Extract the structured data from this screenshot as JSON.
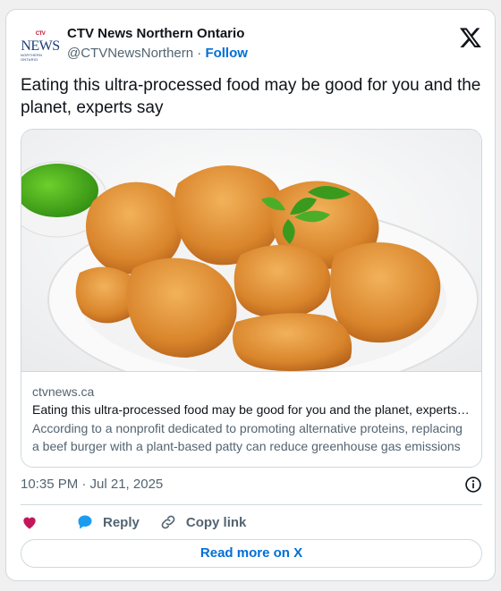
{
  "account": {
    "display_name": "CTV News Northern Ontario",
    "handle": "@CTVNewsNorthern",
    "separator": "·",
    "follow_label": "Follow",
    "logo": {
      "top": "CTV",
      "main": "NEWS",
      "sub": "NORTHERN ONTARIO"
    }
  },
  "tweet": {
    "text": "Eating this ultra-processed food may be good for you and the planet, experts say"
  },
  "link_card": {
    "image_icon": "chicken-nuggets-photo",
    "domain": "ctvnews.ca",
    "title": "Eating this ultra-processed food may be good for you and the planet, experts say",
    "description": "According to a nonprofit dedicated to promoting alternative proteins, replacing a beef burger with a plant-based patty can reduce greenhouse gas emissions"
  },
  "meta": {
    "timestamp": "10:35 PM · Jul 21, 2025"
  },
  "actions": {
    "reply_label": "Reply",
    "copy_label": "Copy link",
    "read_more_label": "Read more on X"
  },
  "colors": {
    "accent": "#006fd6",
    "heart": "#c2185b",
    "reply_bubble": "#1d9bf0",
    "muted_text": "#536471",
    "border": "#cfd9de"
  }
}
